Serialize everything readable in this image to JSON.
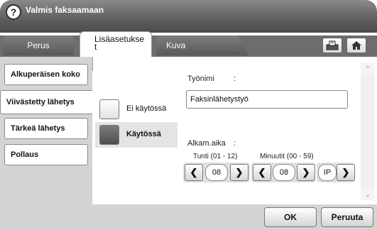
{
  "title": "Valmis faksaamaan",
  "help_label": "?",
  "tabs": [
    {
      "label": "Perus"
    },
    {
      "label_line1": "Lisäasetukse",
      "label_line2": "t"
    },
    {
      "label": "Kuva"
    }
  ],
  "sidebar": {
    "items": [
      {
        "label": "Alkuperäisen koko"
      },
      {
        "label": "Viivästetty lähetys"
      },
      {
        "label": "Tärkeä lähetys"
      },
      {
        "label": "Pollaus"
      }
    ]
  },
  "options": {
    "off_label": "Ei käytössä",
    "on_label": "Käytössä"
  },
  "job": {
    "label": "Työnimi",
    "colon": ":",
    "value": "Faksinlähetystyö"
  },
  "start_time": {
    "label": "Alkam.aika",
    "colon": ":",
    "hour_label": "Tunti (01 - 12)",
    "minute_label": "Minuutit (00 - 59)",
    "hour_value": "08",
    "minute_value": "08",
    "ampm_value": "IP"
  },
  "buttons": {
    "ok": "OK",
    "cancel": "Peruuta"
  }
}
